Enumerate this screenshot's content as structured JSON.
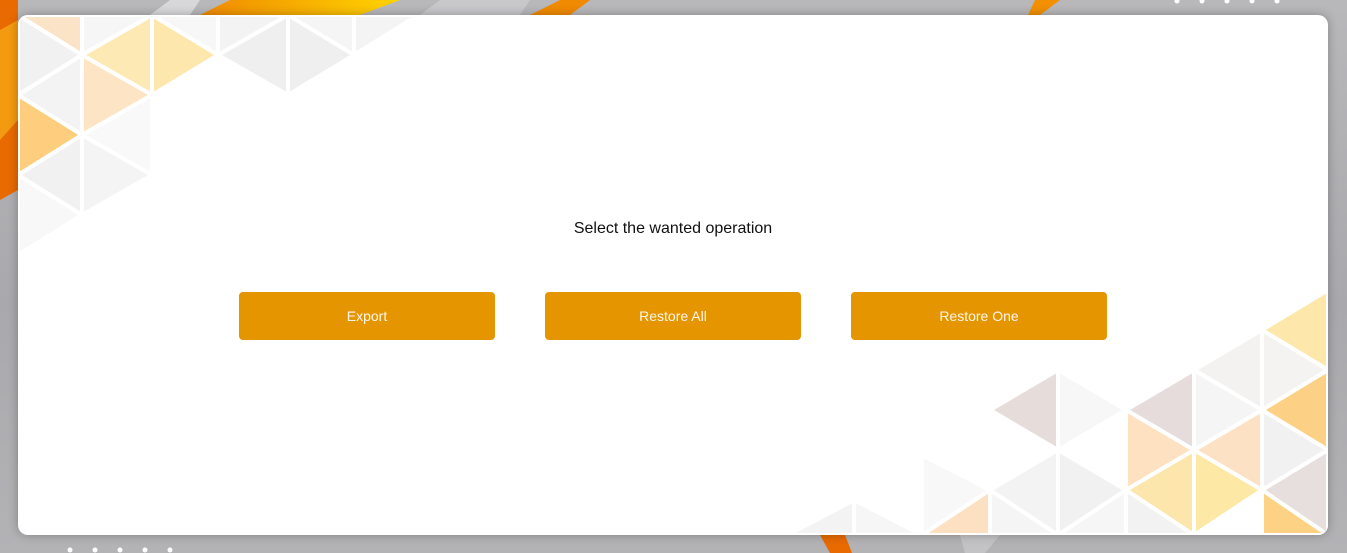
{
  "dialog": {
    "prompt": "Select the wanted operation",
    "buttons": {
      "export": "Export",
      "restore_all": "Restore All",
      "restore_one": "Restore One"
    }
  },
  "colors": {
    "accent": "#e59500",
    "button_text": "#fff7ea",
    "card_background": "#ffffff",
    "page_background": "#b0b0b4"
  }
}
